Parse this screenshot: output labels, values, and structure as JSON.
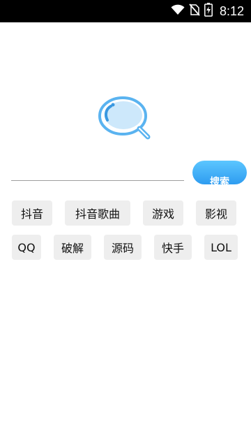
{
  "status_bar": {
    "time": "8:12",
    "icons": [
      "wifi-icon",
      "no-sim-icon",
      "battery-charging-icon"
    ]
  },
  "logo": {
    "icon": "magnifier-logo-icon",
    "color": "#5ab3f0"
  },
  "search": {
    "value": "",
    "button_label": "搜索"
  },
  "tags": [
    {
      "label": "抖音"
    },
    {
      "label": "抖音歌曲"
    },
    {
      "label": "游戏"
    },
    {
      "label": "影视"
    },
    {
      "label": "QQ"
    },
    {
      "label": "破解"
    },
    {
      "label": "源码"
    },
    {
      "label": "快手"
    },
    {
      "label": "LOL"
    }
  ],
  "colors": {
    "accent": "#3aa8f5",
    "tag_background": "#eeeeee"
  }
}
